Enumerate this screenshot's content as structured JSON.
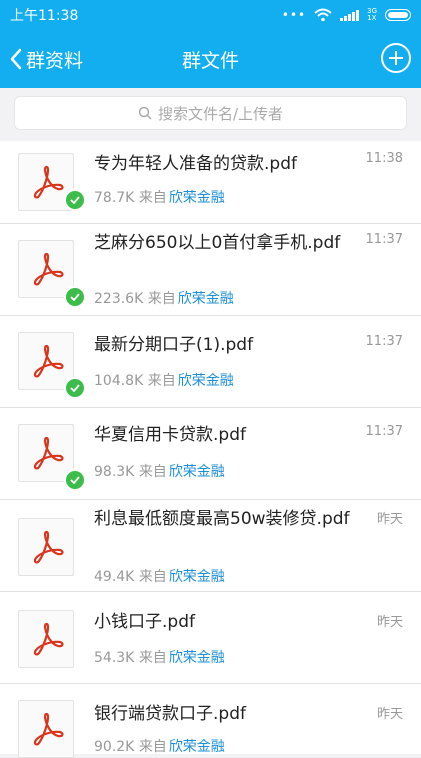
{
  "status": {
    "time": "上午11:38",
    "network": [
      "3G",
      "1X"
    ]
  },
  "nav": {
    "back_label": "群资料",
    "title": "群文件"
  },
  "search": {
    "placeholder": "搜索文件名/上传者"
  },
  "colors": {
    "accent": "#12aef0",
    "link": "#1d8fd8",
    "check": "#3cbd4a",
    "pdf": "#d9351c"
  },
  "from_label": "来自",
  "files": [
    {
      "name": "专为年轻人准备的贷款.pdf",
      "size": "78.7K",
      "uploader": "欣荣金融",
      "time": "11:38",
      "downloaded": true
    },
    {
      "name": "芝麻分650以上0首付拿手机.pdf",
      "size": "223.6K",
      "uploader": "欣荣金融",
      "time": "11:37",
      "downloaded": true
    },
    {
      "name": "最新分期口子(1).pdf",
      "size": "104.8K",
      "uploader": "欣荣金融",
      "time": "11:37",
      "downloaded": true
    },
    {
      "name": "华夏信用卡贷款.pdf",
      "size": "98.3K",
      "uploader": "欣荣金融",
      "time": "11:37",
      "downloaded": true
    },
    {
      "name": "利息最低额度最高50w装修贷.pdf",
      "size": "49.4K",
      "uploader": "欣荣金融",
      "time": "昨天",
      "downloaded": false
    },
    {
      "name": "小钱口子.pdf",
      "size": "54.3K",
      "uploader": "欣荣金融",
      "time": "昨天",
      "downloaded": false
    },
    {
      "name": "银行端贷款口子.pdf",
      "size": "90.2K",
      "uploader": "欣荣金融",
      "time": "昨天",
      "downloaded": false
    }
  ]
}
